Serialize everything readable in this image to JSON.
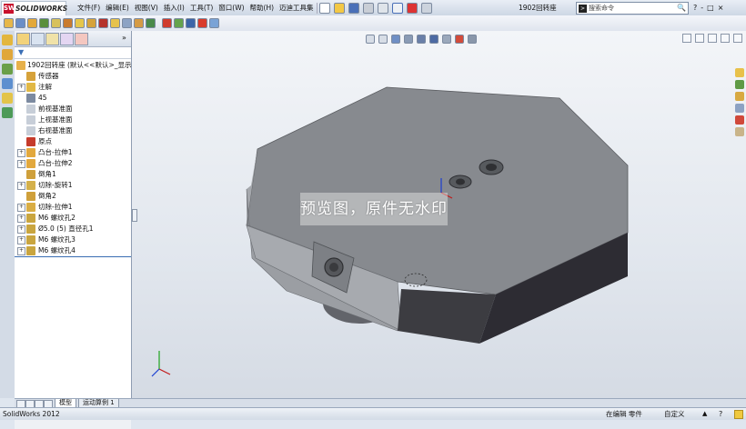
{
  "app": {
    "brand": "SOLIDWORKS",
    "doc_title": "1902回转座"
  },
  "menu": [
    "文件(F)",
    "编辑(E)",
    "视图(V)",
    "插入(I)",
    "工具(T)",
    "窗口(W)",
    "帮助(H)",
    "迈迪工具集"
  ],
  "search": {
    "placeholder": "搜索命令"
  },
  "window_controls": [
    "?",
    "-",
    "□",
    "×"
  ],
  "feature_tree": {
    "filter_icon": "funnel-icon",
    "root": "1902回转座  (默认<<默认>_显示状",
    "items": [
      {
        "label": "传感器",
        "icon": "sensor-icon",
        "expandable": false
      },
      {
        "label": "注解",
        "icon": "annotation-icon",
        "expandable": true
      },
      {
        "label": "45",
        "icon": "material-icon",
        "expandable": false
      },
      {
        "label": "前视基准面",
        "icon": "plane-icon",
        "expandable": false
      },
      {
        "label": "上视基准面",
        "icon": "plane-icon",
        "expandable": false
      },
      {
        "label": "右视基准面",
        "icon": "plane-icon",
        "expandable": false
      },
      {
        "label": "原点",
        "icon": "origin-icon",
        "expandable": false
      },
      {
        "label": "凸台-拉伸1",
        "icon": "extrude-icon",
        "expandable": true
      },
      {
        "label": "凸台-拉伸2",
        "icon": "extrude-icon",
        "expandable": true
      },
      {
        "label": "倒角1",
        "icon": "chamfer-icon",
        "expandable": false
      },
      {
        "label": "切除-旋转1",
        "icon": "revolve-cut-icon",
        "expandable": true
      },
      {
        "label": "倒角2",
        "icon": "chamfer-icon",
        "expandable": false
      },
      {
        "label": "切除-拉伸1",
        "icon": "extrude-cut-icon",
        "expandable": true
      },
      {
        "label": "M6 螺纹孔2",
        "icon": "hole-icon",
        "expandable": true
      },
      {
        "label": "Ø5.0 (5) 直径孔1",
        "icon": "hole-icon",
        "expandable": true
      },
      {
        "label": "M6 螺纹孔3",
        "icon": "hole-icon",
        "expandable": true
      },
      {
        "label": "M6 螺纹孔4",
        "icon": "hole-icon",
        "expandable": true
      }
    ]
  },
  "bottom_tabs": [
    "模型",
    "运动算例 1"
  ],
  "status": {
    "app_version": "SolidWorks 2012",
    "editing": "在编辑 零件",
    "custom": "自定义"
  },
  "watermark": "预览图，原件无水印",
  "colors": {
    "part_face": "#878a8f",
    "part_side": "#3f3f44",
    "accent": "#3a6db3"
  }
}
